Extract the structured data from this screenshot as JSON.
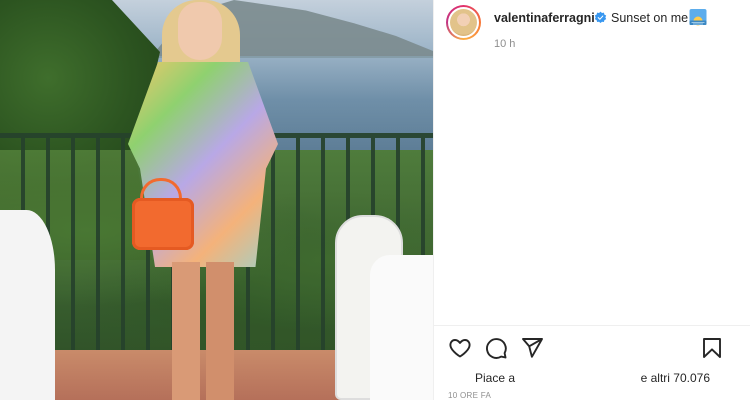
{
  "post": {
    "photo": {
      "icon": "photo-of-woman-on-terrace-at-sunset"
    },
    "header": {
      "username": "valentinaferragni",
      "verified_icon": "verified-badge-icon",
      "caption_text": "Sunset on me",
      "caption_emoji": "sunset-emoji",
      "time_ago": "10 h"
    },
    "actions": {
      "like_icon": "heart-icon",
      "comment_icon": "comment-icon",
      "share_icon": "share-icon",
      "save_icon": "bookmark-icon"
    },
    "likes": {
      "prefix": "Piace a",
      "suffix": "e altri 70.076"
    },
    "timestamp": "10 ORE FA"
  },
  "colors": {
    "text": "#262626",
    "muted": "#8e8e8e",
    "verified_blue": "#3897f0",
    "divider": "#efefef"
  }
}
